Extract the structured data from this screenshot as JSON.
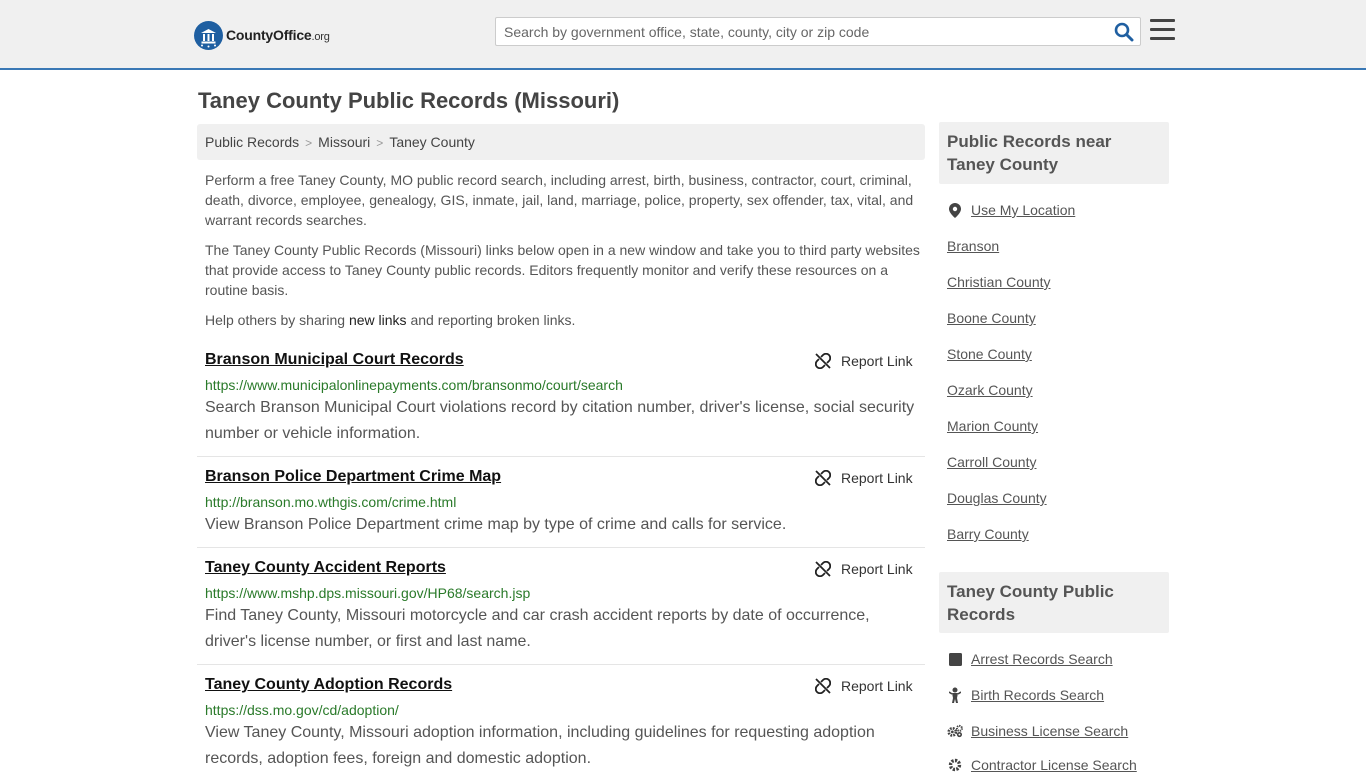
{
  "header": {
    "logo_main": "CountyOffice",
    "logo_suffix": ".org",
    "search_placeholder": "Search by government office, state, county, city or zip code"
  },
  "page_title": "Taney County Public Records (Missouri)",
  "breadcrumb": [
    "Public Records",
    "Missouri",
    "Taney County"
  ],
  "intro": {
    "p1": "Perform a free Taney County, MO public record search, including arrest, birth, business, contractor, court, criminal, death, divorce, employee, genealogy, GIS, inmate, jail, land, marriage, police, property, sex offender, tax, vital, and warrant records searches.",
    "p2": "The Taney County Public Records (Missouri) links below open in a new window and take you to third party websites that provide access to Taney County public records. Editors frequently monitor and verify these resources on a routine basis.",
    "p3_before": "Help others by sharing ",
    "p3_link": "new links",
    "p3_after": " and reporting broken links."
  },
  "report_label": "Report Link",
  "records": [
    {
      "title": "Branson Municipal Court Records",
      "url": "https://www.municipalonlinepayments.com/bransonmo/court/search",
      "desc": "Search Branson Municipal Court violations record by citation number, driver's license, social security number or vehicle information."
    },
    {
      "title": "Branson Police Department Crime Map",
      "url": "http://branson.mo.wthgis.com/crime.html",
      "desc": "View Branson Police Department crime map by type of crime and calls for service."
    },
    {
      "title": "Taney County Accident Reports",
      "url": "https://www.mshp.dps.missouri.gov/HP68/search.jsp",
      "desc": "Find Taney County, Missouri motorcycle and car crash accident reports by date of occurrence, driver's license number, or first and last name."
    },
    {
      "title": "Taney County Adoption Records",
      "url": "https://dss.mo.gov/cd/adoption/",
      "desc": "View Taney County, Missouri adoption information, including guidelines for requesting adoption records, adoption fees, foreign and domestic adoption."
    }
  ],
  "sidebar": {
    "near_heading": "Public Records near Taney County",
    "use_location": "Use My Location",
    "near_links": [
      "Branson",
      "Christian County",
      "Boone County",
      "Stone County",
      "Ozark County",
      "Marion County",
      "Carroll County",
      "Douglas County",
      "Barry County"
    ],
    "county_heading": "Taney County Public Records",
    "county_links": [
      {
        "label": "Arrest Records Search",
        "icon": "square-icon"
      },
      {
        "label": "Birth Records Search",
        "icon": "baby-icon"
      },
      {
        "label": "Business License Search",
        "icon": "gears-icon"
      },
      {
        "label": "Contractor License Search",
        "icon": "gear-icon"
      }
    ]
  }
}
